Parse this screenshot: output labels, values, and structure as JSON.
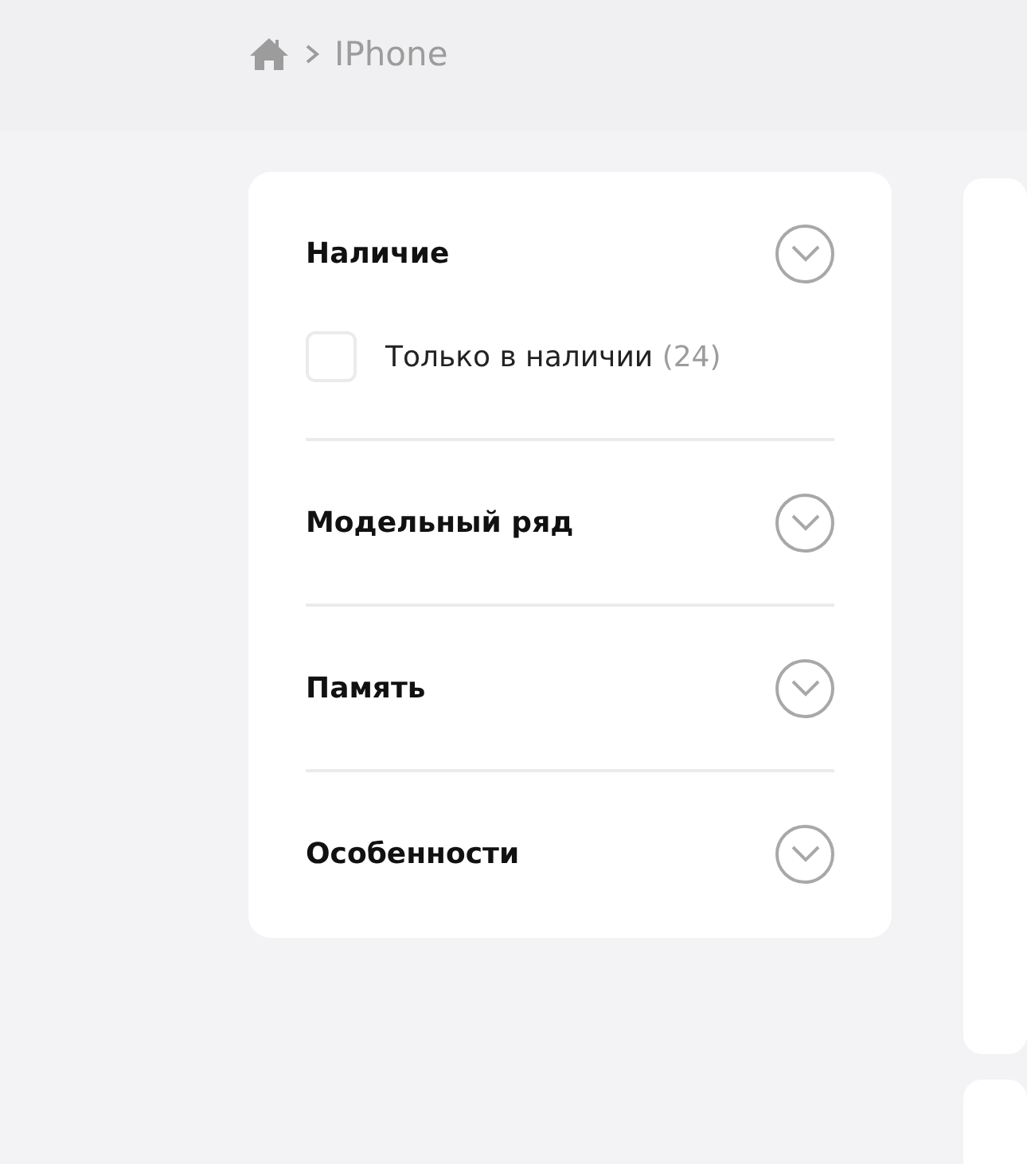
{
  "breadcrumb": {
    "current": "IPhone"
  },
  "filters": [
    {
      "title": "Наличие",
      "options": [
        {
          "label": "Только в наличии",
          "count": "(24)",
          "checked": false
        }
      ]
    },
    {
      "title": "Модельный ряд"
    },
    {
      "title": "Память"
    },
    {
      "title": "Особенности"
    }
  ]
}
